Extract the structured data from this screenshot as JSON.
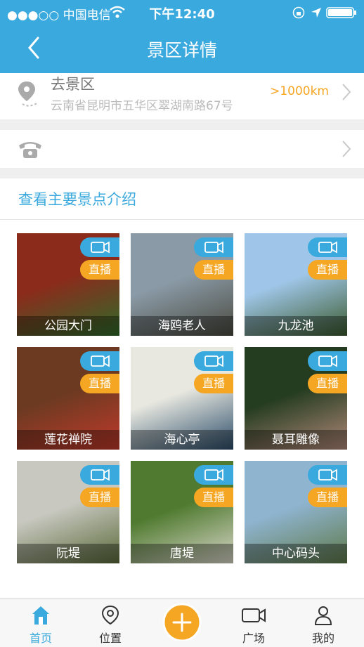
{
  "status_bar": {
    "carrier": "●●●○○ 中国电信",
    "time": "下午12:40"
  },
  "navbar": {
    "title": "景区详情"
  },
  "address": {
    "label": "去景区",
    "detail": "云南省昆明市五华区翠湖南路67号",
    "distance": ">1000km"
  },
  "section": {
    "title": "查看主要景点介绍"
  },
  "badge": {
    "live": "直播"
  },
  "spots": [
    {
      "name": "公园大门",
      "colors": [
        "#8b2b1c",
        "#2f6b2a"
      ]
    },
    {
      "name": "海鸥老人",
      "colors": [
        "#8a9aa6",
        "#4a4a40"
      ]
    },
    {
      "name": "九龙池",
      "colors": [
        "#9fc6e8",
        "#3c5b2f"
      ]
    },
    {
      "name": "莲花禅院",
      "colors": [
        "#6b3a21",
        "#c0392b"
      ]
    },
    {
      "name": "海心亭",
      "colors": [
        "#e8e8e0",
        "#2c4d6a"
      ]
    },
    {
      "name": "聂耳雕像",
      "colors": [
        "#243c20",
        "#b08878"
      ]
    },
    {
      "name": "阮堤",
      "colors": [
        "#c8c8c0",
        "#5b6a3a"
      ]
    },
    {
      "name": "唐堤",
      "colors": [
        "#4f7a2f",
        "#d8d6c8"
      ]
    },
    {
      "name": "中心码头",
      "colors": [
        "#8fb4d0",
        "#5f7a4a"
      ]
    }
  ],
  "tabs": [
    {
      "label": "首页",
      "icon": "home-icon",
      "active": true
    },
    {
      "label": "位置",
      "icon": "location-icon",
      "active": false
    },
    {
      "label": "广场",
      "icon": "video-icon",
      "active": false
    },
    {
      "label": "我的",
      "icon": "user-icon",
      "active": false
    }
  ],
  "colors": {
    "primary": "#3aa9dd",
    "accent": "#f5a623"
  }
}
